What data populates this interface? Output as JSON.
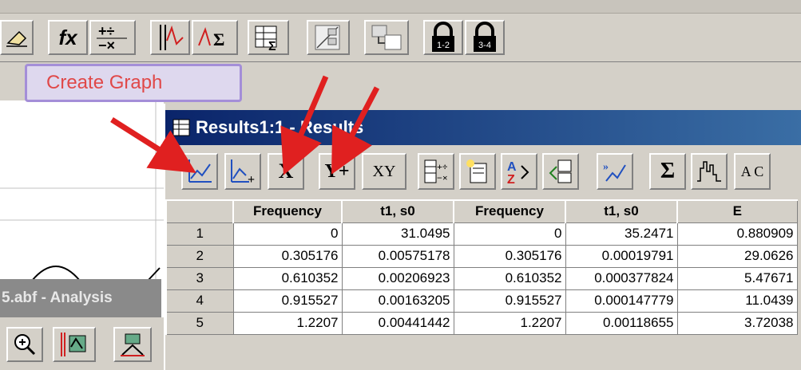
{
  "tooltip": {
    "label": "Create Graph"
  },
  "analysis_window": {
    "title": "5.abf - Analysis"
  },
  "results_window": {
    "title": "Results1:1 - Results",
    "toolbar": [
      {
        "name": "create-graph-icon",
        "label": ""
      },
      {
        "name": "append-graph-icon",
        "label": ""
      },
      {
        "name": "set-x-button",
        "label": "X"
      },
      {
        "name": "set-y-button",
        "label": "Y+"
      },
      {
        "name": "set-xy-button",
        "label": "XY"
      },
      {
        "name": "column-arithmetic-icon",
        "label": ""
      },
      {
        "name": "new-sheet-icon",
        "label": ""
      },
      {
        "name": "sort-icon",
        "label": ""
      },
      {
        "name": "import-icon",
        "label": ""
      },
      {
        "name": "interpolate-icon",
        "label": ""
      },
      {
        "name": "sum-icon",
        "label": "Σ"
      },
      {
        "name": "histogram-icon",
        "label": ""
      },
      {
        "name": "text-format-icon",
        "label": "A C"
      }
    ],
    "columns": [
      "",
      "Frequency",
      "t1, s0",
      "Frequency",
      "t1, s0",
      "E"
    ],
    "rows": [
      [
        "1",
        "0",
        "31.0495",
        "0",
        "35.2471",
        "0.880909"
      ],
      [
        "2",
        "0.305176",
        "0.00575178",
        "0.305176",
        "0.00019791",
        "29.0626"
      ],
      [
        "3",
        "0.610352",
        "0.00206923",
        "0.610352",
        "0.000377824",
        "5.47671"
      ],
      [
        "4",
        "0.915527",
        "0.00163205",
        "0.915527",
        "0.000147779",
        "11.0439"
      ],
      [
        "5",
        "1.2207",
        "0.00441442",
        "1.2207",
        "0.00118655",
        "3.72038"
      ]
    ]
  },
  "main_toolbar": {
    "lock_labels": [
      "1-2",
      "3-4"
    ],
    "fx_label": "fx",
    "sigma_label": "Σ"
  },
  "colors": {
    "annotation_red": "#e02020",
    "tooltip_border": "#a48ed8",
    "title_start": "#0a246a",
    "title_end": "#3a6ea5"
  }
}
